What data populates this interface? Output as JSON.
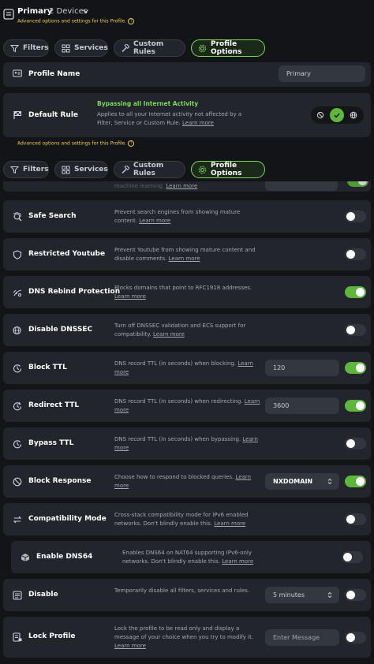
{
  "header": {
    "title": "Primary",
    "devices": "2 Devices",
    "subtitle": "Advanced options and settings for this Profile."
  },
  "tabs": [
    {
      "label": "Filters",
      "active": false
    },
    {
      "label": "Services",
      "active": false
    },
    {
      "label": "Custom Rules",
      "active": false
    },
    {
      "label": "Profile Options",
      "active": true
    }
  ],
  "profile_name": {
    "title": "Profile Name",
    "value": "Primary"
  },
  "default_rule": {
    "title": "Default Rule",
    "status": "Bypassing all Internet Activity",
    "description": "Applies to all your Internet activity not affected by a Filter, Service or Custom Rule.",
    "link": "Learn more",
    "options": [
      "block-icon",
      "bypass-check-icon",
      "redirect-globe-icon"
    ],
    "selected": "bypass-check-icon"
  },
  "sticky": {
    "subtitle": "Advanced options and settings for this Profile.",
    "partial_text": "machine learning.",
    "partial_link": "Learn more"
  },
  "rows": [
    {
      "title": "Safe Search",
      "desc": "Prevent search engines from showing mature content.",
      "link": "Learn more",
      "toggle": false
    },
    {
      "title": "Restricted Youtube",
      "desc": "Prevent Youtube from showing mature content and disable comments.",
      "link": "Learn more",
      "toggle": false
    },
    {
      "title": "DNS Rebind Protection",
      "desc": "Blocks domains that point to RFC1918 addresses.",
      "link": "Learn more",
      "toggle": true
    },
    {
      "title": "Disable DNSSEC",
      "desc": "Turn off DNSSEC validation and ECS support for compatibility.",
      "link": "Learn more",
      "toggle": false
    },
    {
      "title": "Block TTL",
      "desc": "DNS record TTL (in seconds) when blocking.",
      "link": "Learn more",
      "toggle": true,
      "field": "120"
    },
    {
      "title": "Redirect TTL",
      "desc": "DNS record TTL (in seconds) when redirecting.",
      "link": "Learn more",
      "toggle": true,
      "field": "3600"
    },
    {
      "title": "Bypass TTL",
      "desc": "DNS record TTL (in seconds) when bypassing.",
      "link": "Learn more",
      "toggle": false
    },
    {
      "title": "Block Response",
      "desc": "Choose how to respond to blocked queries.",
      "link": "Learn more",
      "toggle": true,
      "select": "NXDOMAIN"
    },
    {
      "title": "Compatibility Mode",
      "desc": "Cross-stack compatibility mode for IPv6 enabled networks. Don't blindly enable this.",
      "link": "Learn more",
      "toggle": false
    },
    {
      "title": "Enable DNS64",
      "desc": "Enables DNS64 on NAT64 supporting IPv6-only networks. Don't blindly enable this.",
      "link": "Learn more",
      "toggle": false
    },
    {
      "title": "Disable",
      "desc": "Temporarily disable all filters, services and rules.",
      "link": "",
      "toggle": false,
      "select": "5 minutes"
    },
    {
      "title": "Lock Profile",
      "desc": "Lock the profile to be read only and display a message of your choice when you try to modify it.",
      "link": "Learn more",
      "toggle": false,
      "placeholder": "Enter Message"
    }
  ],
  "colors": {
    "accent": "#7ed957",
    "toggle_on": "#5db73b",
    "warning": "#f1cc46",
    "card": "#22252b",
    "background": "#121418"
  }
}
